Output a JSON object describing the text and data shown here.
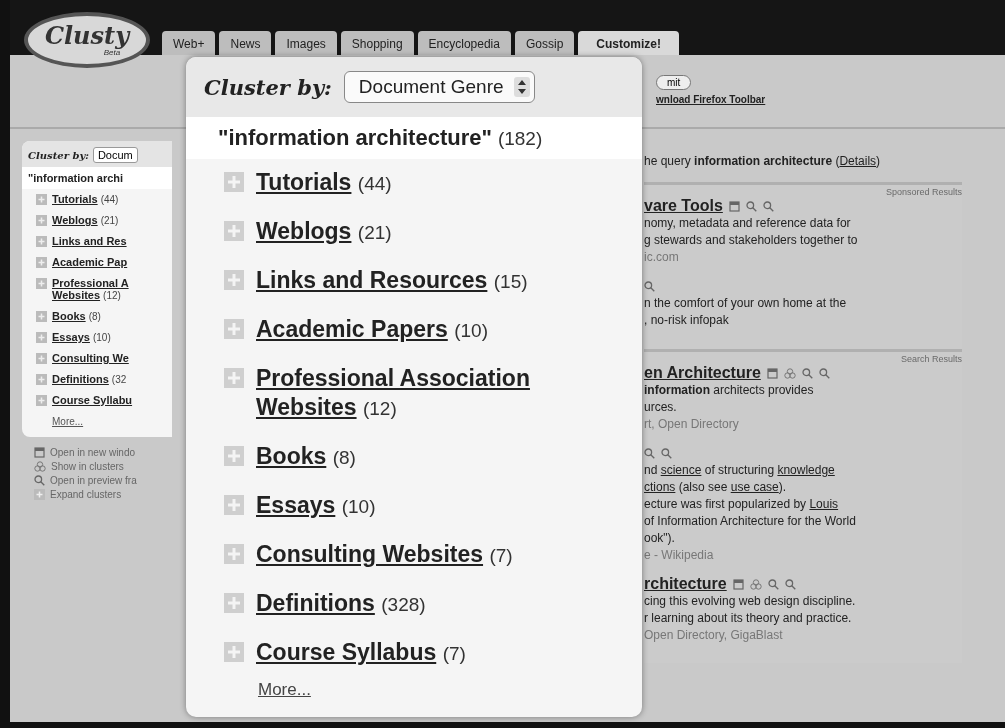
{
  "header": {
    "logo": "Clusty",
    "logo_badge": "Beta",
    "submit_button": "mit",
    "toolbar_link": "wnload Firefox Toolbar"
  },
  "tabs": [
    {
      "label": "Web+",
      "selected": false
    },
    {
      "label": "News",
      "selected": false
    },
    {
      "label": "Images",
      "selected": false
    },
    {
      "label": "Shopping",
      "selected": false
    },
    {
      "label": "Encyclopedia",
      "selected": false
    },
    {
      "label": "Gossip",
      "selected": false
    },
    {
      "label": "Customize!",
      "selected": true
    }
  ],
  "sidebar": {
    "cluster_by_label": "Cluster by:",
    "cluster_by_value": "Docum",
    "root": "\"information archi",
    "clusters": [
      {
        "label": "Tutorials",
        "count": "(44)"
      },
      {
        "label": "Weblogs",
        "count": "(21)"
      },
      {
        "label": "Links and Res"
      },
      {
        "label": "Academic Pap"
      },
      {
        "label": "Professional A",
        "label_cont": "Websites",
        "count": "(12)"
      },
      {
        "label": "Books",
        "count": "(8)"
      },
      {
        "label": "Essays",
        "count": "(10)"
      },
      {
        "label": "Consulting We"
      },
      {
        "label": "Definitions",
        "count": "(32"
      },
      {
        "label": "Course Syllabu"
      }
    ],
    "more": "More...",
    "legend": [
      {
        "kind": "window",
        "label": "Open in new windo"
      },
      {
        "kind": "clusters",
        "label": "Show in clusters"
      },
      {
        "kind": "magnifier",
        "label": "Open in preview fra"
      },
      {
        "kind": "expand",
        "label": "Expand clusters"
      }
    ]
  },
  "magnifier": {
    "cluster_by_label": "Cluster by:",
    "cluster_by_value": "Document Genre",
    "root": "\"information architecture\"",
    "root_count": "(182)",
    "clusters": [
      {
        "label": "Tutorials",
        "count": "(44)"
      },
      {
        "label": "Weblogs",
        "count": "(21)"
      },
      {
        "label": "Links and Resources",
        "count": "(15)"
      },
      {
        "label": "Academic Papers",
        "count": "(10)"
      },
      {
        "label": "Professional Association Websites",
        "count": "(12)"
      },
      {
        "label": "Books",
        "count": "(8)"
      },
      {
        "label": "Essays",
        "count": "(10)"
      },
      {
        "label": "Consulting Websites",
        "count": "(7)"
      },
      {
        "label": "Definitions",
        "count": "(328)"
      },
      {
        "label": "Course Syllabus",
        "count": "(7)"
      }
    ],
    "more": "More..."
  },
  "results": {
    "query_line": [
      {
        "kind": "plain",
        "text": "he query "
      },
      {
        "kind": "bold",
        "text": "information architecture"
      },
      {
        "kind": "plain",
        "text": " ("
      },
      {
        "kind": "link",
        "text": "Details"
      },
      {
        "kind": "plain",
        "text": ")"
      }
    ],
    "sponsored_label": "Sponsored Results",
    "sponsored": [
      {
        "title": "vare Tools",
        "lines": [
          [
            {
              "kind": "plain",
              "text": "nomy, metadata and reference data for"
            }
          ],
          [
            {
              "kind": "plain",
              "text": "g stewards and stakeholders together to"
            }
          ]
        ],
        "source": "ic.com"
      },
      {
        "lines": [
          [
            {
              "kind": "plain",
              "text": "n the comfort of your own home at the"
            }
          ],
          [
            {
              "kind": "plain",
              "text": ", no-risk infopak"
            }
          ]
        ]
      }
    ],
    "search_label": "Search Results",
    "search": [
      {
        "title": "en Architecture",
        "lines": [
          [
            {
              "kind": "bold",
              "text": "information"
            },
            {
              "kind": "plain",
              "text": " architects provides"
            }
          ],
          [
            {
              "kind": "plain",
              "text": "urces."
            }
          ]
        ],
        "source": "rt, Open Directory"
      },
      {
        "lines": [
          [
            {
              "kind": "plain",
              "text": "nd "
            },
            {
              "kind": "link",
              "text": "science"
            },
            {
              "kind": "plain",
              "text": " of structuring "
            },
            {
              "kind": "link",
              "text": "knowledge"
            }
          ],
          [
            {
              "kind": "link",
              "text": "ctions"
            },
            {
              "kind": "plain",
              "text": " (also see "
            },
            {
              "kind": "link",
              "text": "use case"
            },
            {
              "kind": "plain",
              "text": ")."
            }
          ],
          [
            {
              "kind": "plain",
              "text": "ecture was first popularized by "
            },
            {
              "kind": "link",
              "text": "Louis"
            }
          ],
          [
            {
              "kind": "plain",
              "text": "of Information Architecture for the World"
            }
          ],
          [
            {
              "kind": "plain",
              "text": "ook\")."
            }
          ]
        ],
        "source": "e - Wikipedia"
      },
      {
        "title": "rchitecture",
        "lines": [
          [
            {
              "kind": "plain",
              "text": "cing this evolving web design discipline."
            }
          ],
          [
            {
              "kind": "plain",
              "text": "r learning about its theory and practice."
            }
          ]
        ],
        "source": "Open Directory, GigaBlast"
      }
    ]
  }
}
